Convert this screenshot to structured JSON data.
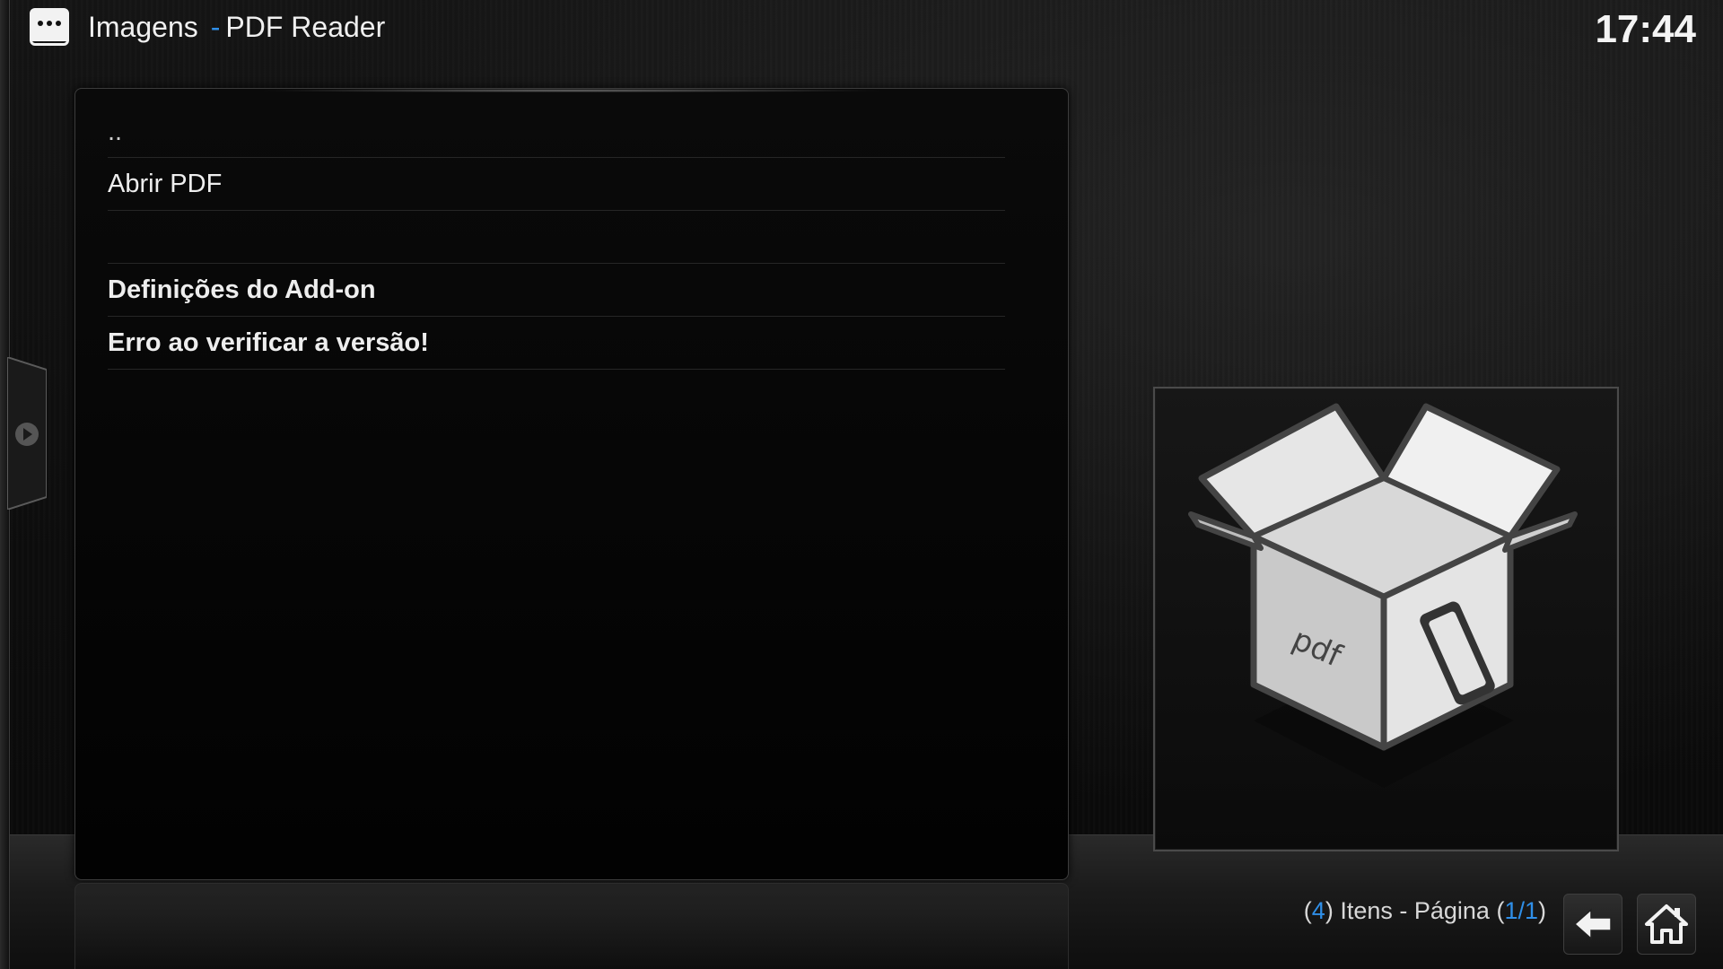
{
  "header": {
    "section": "Imagens",
    "separator": "-",
    "addon_name": "PDF Reader",
    "clock": "17:44"
  },
  "list": {
    "items": [
      {
        "label": "..",
        "style": "parent"
      },
      {
        "label": "Abrir PDF",
        "style": "normal"
      },
      {
        "label": "",
        "style": "normal"
      },
      {
        "label": "Definições do Add-on",
        "style": "bold"
      },
      {
        "label": "Erro ao verificar a versão!",
        "style": "bold"
      }
    ]
  },
  "thumbnail": {
    "icon": "open-box-icon",
    "box_label": "pdf"
  },
  "footer": {
    "count_open": "(",
    "count": "4",
    "count_close": ")",
    "items_text": "Itens - Página",
    "page_open": "(",
    "page": "1/1",
    "page_close": ")",
    "back_icon": "back-arrow-icon",
    "home_icon": "home-icon"
  },
  "colors": {
    "accent": "#2f8fe8",
    "background": "#0c0c0c",
    "text": "#eeeeee"
  }
}
